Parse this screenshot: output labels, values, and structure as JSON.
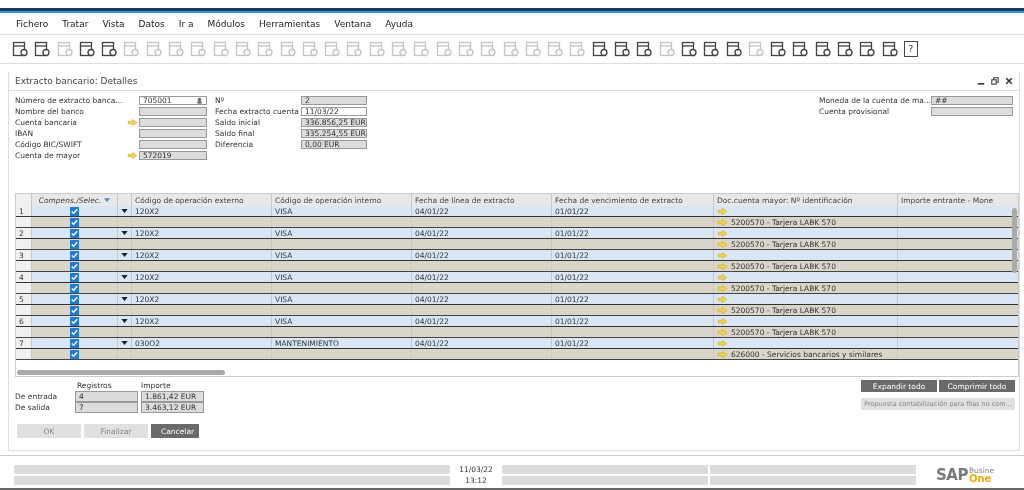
{
  "menu": [
    "Fichero",
    "Tratar",
    "Vista",
    "Datos",
    "Ir a",
    "Módulos",
    "Herramientas",
    "Ventana",
    "Ayuda"
  ],
  "toolbar": [
    {
      "disabled": false
    },
    {
      "disabled": false
    },
    {
      "disabled": true
    },
    {
      "disabled": false
    },
    {
      "disabled": false
    },
    {
      "disabled": true
    },
    {
      "disabled": true
    },
    {
      "disabled": true
    },
    {
      "disabled": true
    },
    {
      "disabled": true
    },
    {
      "disabled": true
    },
    {
      "disabled": true
    },
    {
      "disabled": true
    },
    {
      "disabled": true
    },
    {
      "disabled": true
    },
    {
      "disabled": true
    },
    {
      "disabled": true
    },
    {
      "disabled": true
    },
    {
      "disabled": true
    },
    {
      "disabled": true
    },
    {
      "disabled": true
    },
    {
      "disabled": true
    },
    {
      "disabled": true
    },
    {
      "disabled": true
    },
    {
      "disabled": true
    },
    {
      "disabled": true
    },
    {
      "disabled": false
    },
    {
      "disabled": false
    },
    {
      "disabled": false
    },
    {
      "disabled": true
    },
    {
      "disabled": false
    },
    {
      "disabled": false
    },
    {
      "disabled": false
    },
    {
      "disabled": true
    },
    {
      "disabled": false
    },
    {
      "disabled": false
    },
    {
      "disabled": false
    },
    {
      "disabled": false
    },
    {
      "disabled": false
    },
    {
      "disabled": false
    },
    {
      "disabled": false,
      "glyph": "?"
    }
  ],
  "window": {
    "title": "Extracto bancario: Detalles"
  },
  "form_left": [
    {
      "label": "Número de extracto banca...",
      "value": "705001",
      "editable": true,
      "link": false,
      "lookup": true
    },
    {
      "label": "Nombre del banco",
      "editable": false,
      "link": false,
      "lookup": false
    },
    {
      "label": "Cuenta bancaria",
      "editable": false,
      "link": true,
      "lookup": false
    },
    {
      "label": "IBAN",
      "editable": false,
      "link": false,
      "lookup": false
    },
    {
      "label": "Código BIC/SWIFT",
      "editable": false,
      "link": false,
      "lookup": false
    },
    {
      "label": "Cuenta de mayor",
      "value": "572019",
      "editable": false,
      "link": true,
      "lookup": false
    }
  ],
  "form_middle": [
    {
      "label": "Nº",
      "value": "2",
      "editable": false
    },
    {
      "label": "Fecha extracto cuenta",
      "value": "11/03/22",
      "editable": true
    },
    {
      "label": "Saldo inicial",
      "value": "336.856,25 EUR",
      "editable": false
    },
    {
      "label": "Saldo final",
      "value": "335.254,55 EUR",
      "editable": false
    },
    {
      "label": "Diferencia",
      "value": "0,00 EUR",
      "editable": false
    }
  ],
  "form_right": [
    {
      "label": "Moneda de la cuenta de ma...",
      "value": "##",
      "editable": false
    },
    {
      "label": "Cuenta provisional",
      "editable": false
    }
  ],
  "table": {
    "columns": [
      "Compens./Selec.",
      "Código de operación externo",
      "Código de operación interno",
      "Fecha de línea de extracto",
      "Fecha de vencimiento de extracto",
      "Doc.cuenta mayor: Nº identificación",
      "Importe entrante - Mone"
    ],
    "rows": [
      {
        "number": "1",
        "checked": true,
        "external": "120X2",
        "internal": "VISA",
        "line_date": "04/01/22",
        "due_date": "01/01/22",
        "sub": {
          "checked": true,
          "account": "5200570 - Tarjera LABK 570"
        }
      },
      {
        "number": "2",
        "checked": true,
        "external": "120X2",
        "internal": "VISA",
        "line_date": "04/01/22",
        "due_date": "01/01/22",
        "sub": {
          "checked": true,
          "account": "5200570 - Tarjera LABK 570"
        }
      },
      {
        "number": "3",
        "checked": true,
        "external": "120X2",
        "internal": "VISA",
        "line_date": "04/01/22",
        "due_date": "01/01/22",
        "sub": {
          "checked": true,
          "account": "5200570 - Tarjera LABK 570"
        }
      },
      {
        "number": "4",
        "checked": true,
        "external": "120X2",
        "internal": "VISA",
        "line_date": "04/01/22",
        "due_date": "01/01/22",
        "sub": {
          "checked": true,
          "account": "5200570 - Tarjera LABK 570"
        }
      },
      {
        "number": "5",
        "checked": true,
        "external": "120X2",
        "internal": "VISA",
        "line_date": "04/01/22",
        "due_date": "01/01/22",
        "sub": {
          "checked": true,
          "account": "5200570 - Tarjera LABK 570"
        }
      },
      {
        "number": "6",
        "checked": true,
        "external": "120X2",
        "internal": "VISA",
        "line_date": "04/01/22",
        "due_date": "01/01/22",
        "sub": {
          "checked": true,
          "account": "5200570 - Tarjera LABK 570"
        }
      },
      {
        "number": "7",
        "checked": true,
        "external": "030O2",
        "internal": "MANTENIMIENTO",
        "line_date": "04/01/22",
        "due_date": "01/01/22",
        "sub": {
          "checked": true,
          "account": "626000 - Servicios bancarios y similares"
        }
      }
    ]
  },
  "totals": {
    "headers": [
      "Registros",
      "Importe"
    ],
    "rows": [
      {
        "label": "De entrada",
        "count": "4",
        "amount": "1.861,42 EUR"
      },
      {
        "label": "De salida",
        "count": "7",
        "amount": "3.463,12 EUR"
      }
    ]
  },
  "side_buttons": [
    {
      "label": "Expandir todo",
      "disabled": false
    },
    {
      "label": "Comprimir todo",
      "disabled": false
    }
  ],
  "proposal_button": {
    "label": "Propuesta contabilización para filas no com...",
    "disabled": true
  },
  "buttons": [
    {
      "label": "OK",
      "disabled": true
    },
    {
      "label": "Finalizar",
      "disabled": true
    },
    {
      "label": "Cancelar",
      "disabled": false
    }
  ],
  "status_bar": {
    "date": "11/03/22",
    "time": "13:12"
  },
  "logo": {
    "brand": "SAP",
    "line1": "Busine",
    "line2": "One"
  }
}
